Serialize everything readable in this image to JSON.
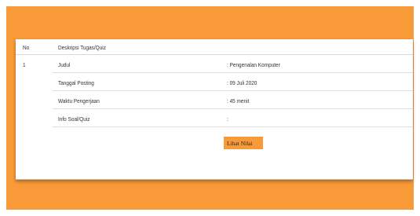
{
  "table": {
    "header": {
      "no": "No",
      "description": "Deskripsi Tugas/Quiz"
    },
    "row_number": "1",
    "rows": [
      {
        "label": "Judul",
        "value": ": Pengenalan Komputer"
      },
      {
        "label": "Tanggal Posting",
        "value": ": 09 Juli 2020"
      },
      {
        "label": "Waktu Pengerjaan",
        "value": ": 45 menit"
      },
      {
        "label": "Info Soal/Quiz",
        "value": ":"
      }
    ],
    "action_label": "Lihat Nilai"
  },
  "colors": {
    "accent": "#f99a38",
    "panel": "#ffffff"
  }
}
